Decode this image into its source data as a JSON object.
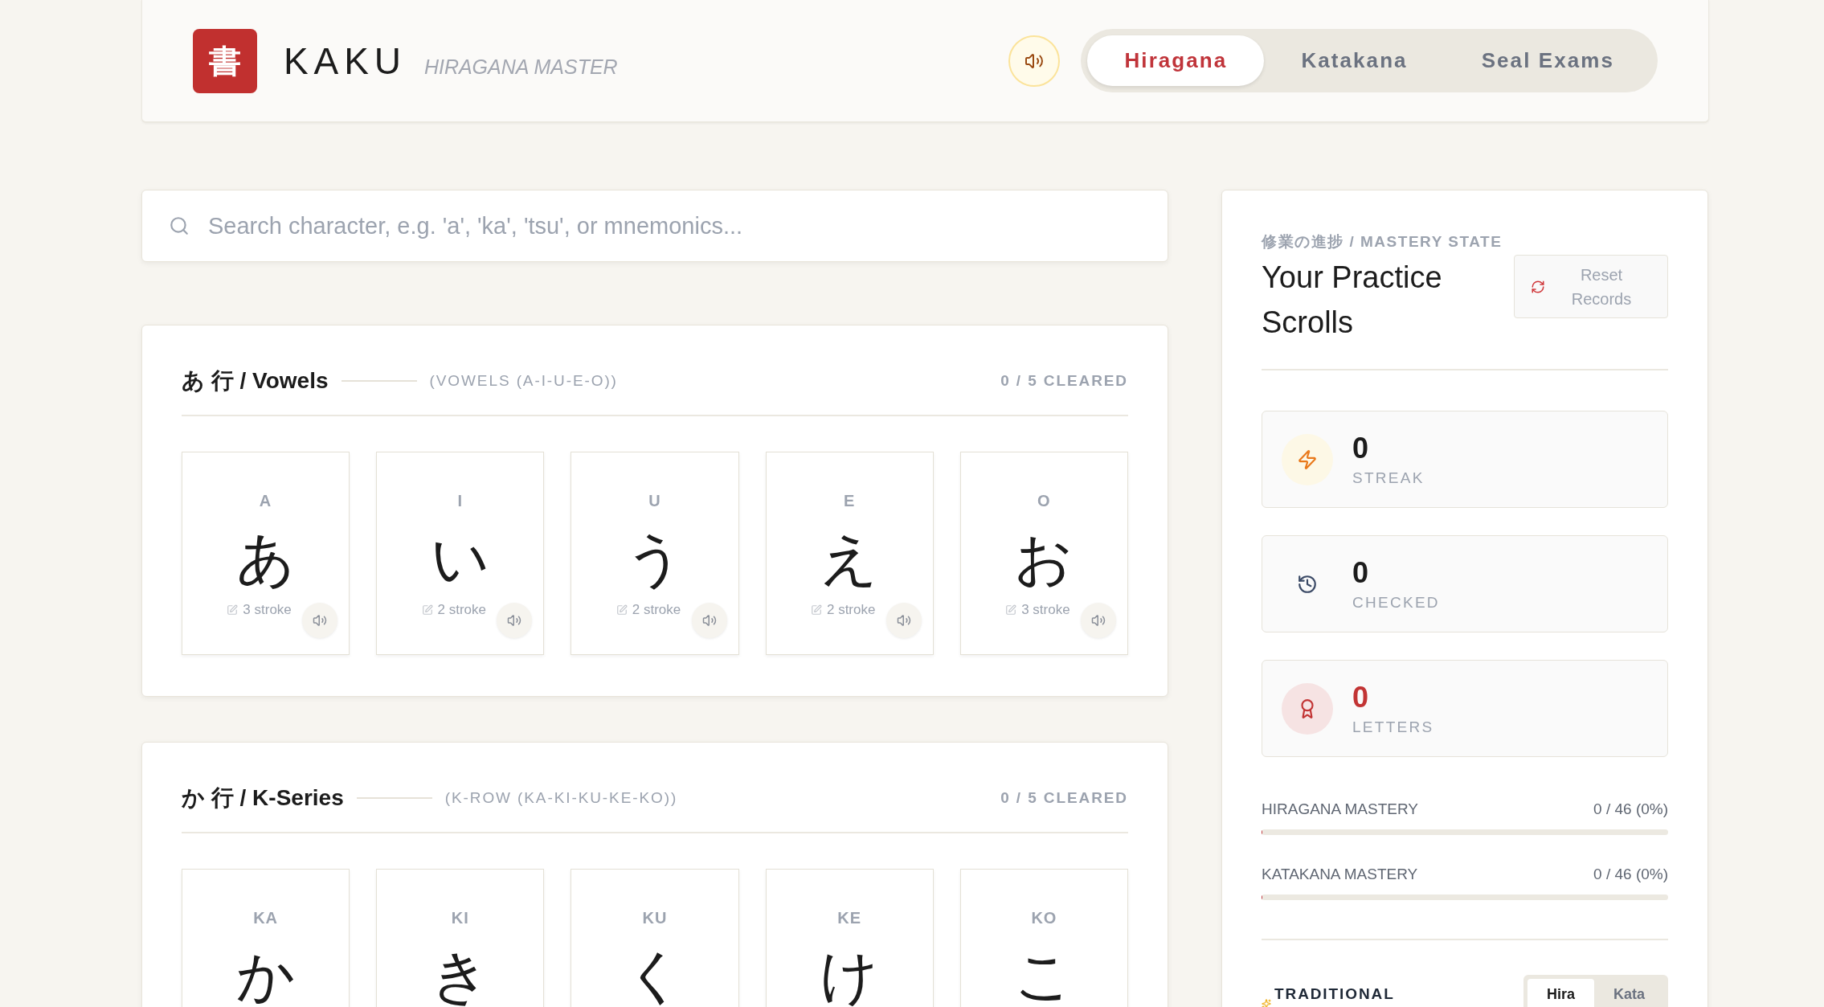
{
  "header": {
    "logo": "書",
    "title": "KAKU",
    "subtitle": "HIRAGANA MASTER",
    "tabs": [
      {
        "label": "Hiragana",
        "selected": true
      },
      {
        "label": "Katakana",
        "selected": false
      },
      {
        "label": "Seal Exams",
        "selected": false
      }
    ]
  },
  "search": {
    "placeholder": "Search character, e.g. 'a', 'ka', 'tsu', or mnemonics..."
  },
  "sections": [
    {
      "title": "あ 行 / Vowels",
      "subtitle": "(VOWELS (A-I-U-E-O))",
      "progress": "0 / 5 CLEARED",
      "cards": [
        {
          "romaji": "A",
          "kana": "あ",
          "strokes": "3 stroke"
        },
        {
          "romaji": "I",
          "kana": "い",
          "strokes": "2 stroke"
        },
        {
          "romaji": "U",
          "kana": "う",
          "strokes": "2 stroke"
        },
        {
          "romaji": "E",
          "kana": "え",
          "strokes": "2 stroke"
        },
        {
          "romaji": "O",
          "kana": "お",
          "strokes": "3 stroke"
        }
      ]
    },
    {
      "title": "か 行 / K-Series",
      "subtitle": "(K-ROW (KA-KI-KU-KE-KO))",
      "progress": "0 / 5 CLEARED",
      "cards": [
        {
          "romaji": "KA",
          "kana": "か"
        },
        {
          "romaji": "KI",
          "kana": "き"
        },
        {
          "romaji": "KU",
          "kana": "く"
        },
        {
          "romaji": "KE",
          "kana": "け"
        },
        {
          "romaji": "KO",
          "kana": "こ"
        }
      ]
    }
  ],
  "mastery_panel": {
    "eyebrow": "修業の進捗 / MASTERY STATE",
    "title": "Your Practice Scrolls",
    "reset_button": "Reset Records",
    "stats": [
      {
        "kind": "streak",
        "value": "0",
        "label": "STREAK"
      },
      {
        "kind": "checked",
        "value": "0",
        "label": "CHECKED"
      },
      {
        "kind": "letters",
        "value": "0",
        "label": "LETTERS"
      }
    ],
    "progress": [
      {
        "label": "HIRAGANA MASTERY",
        "reading": "0 / 46 (0%)",
        "level": 0
      },
      {
        "label": "KATAKANA MASTERY",
        "reading": "0 / 46 (0%)",
        "level": 0
      }
    ],
    "traditional": {
      "title": "TRADITIONAL",
      "toggle": [
        {
          "label": "Hira",
          "selected": true
        },
        {
          "label": "Kata",
          "selected": false
        }
      ]
    }
  }
}
